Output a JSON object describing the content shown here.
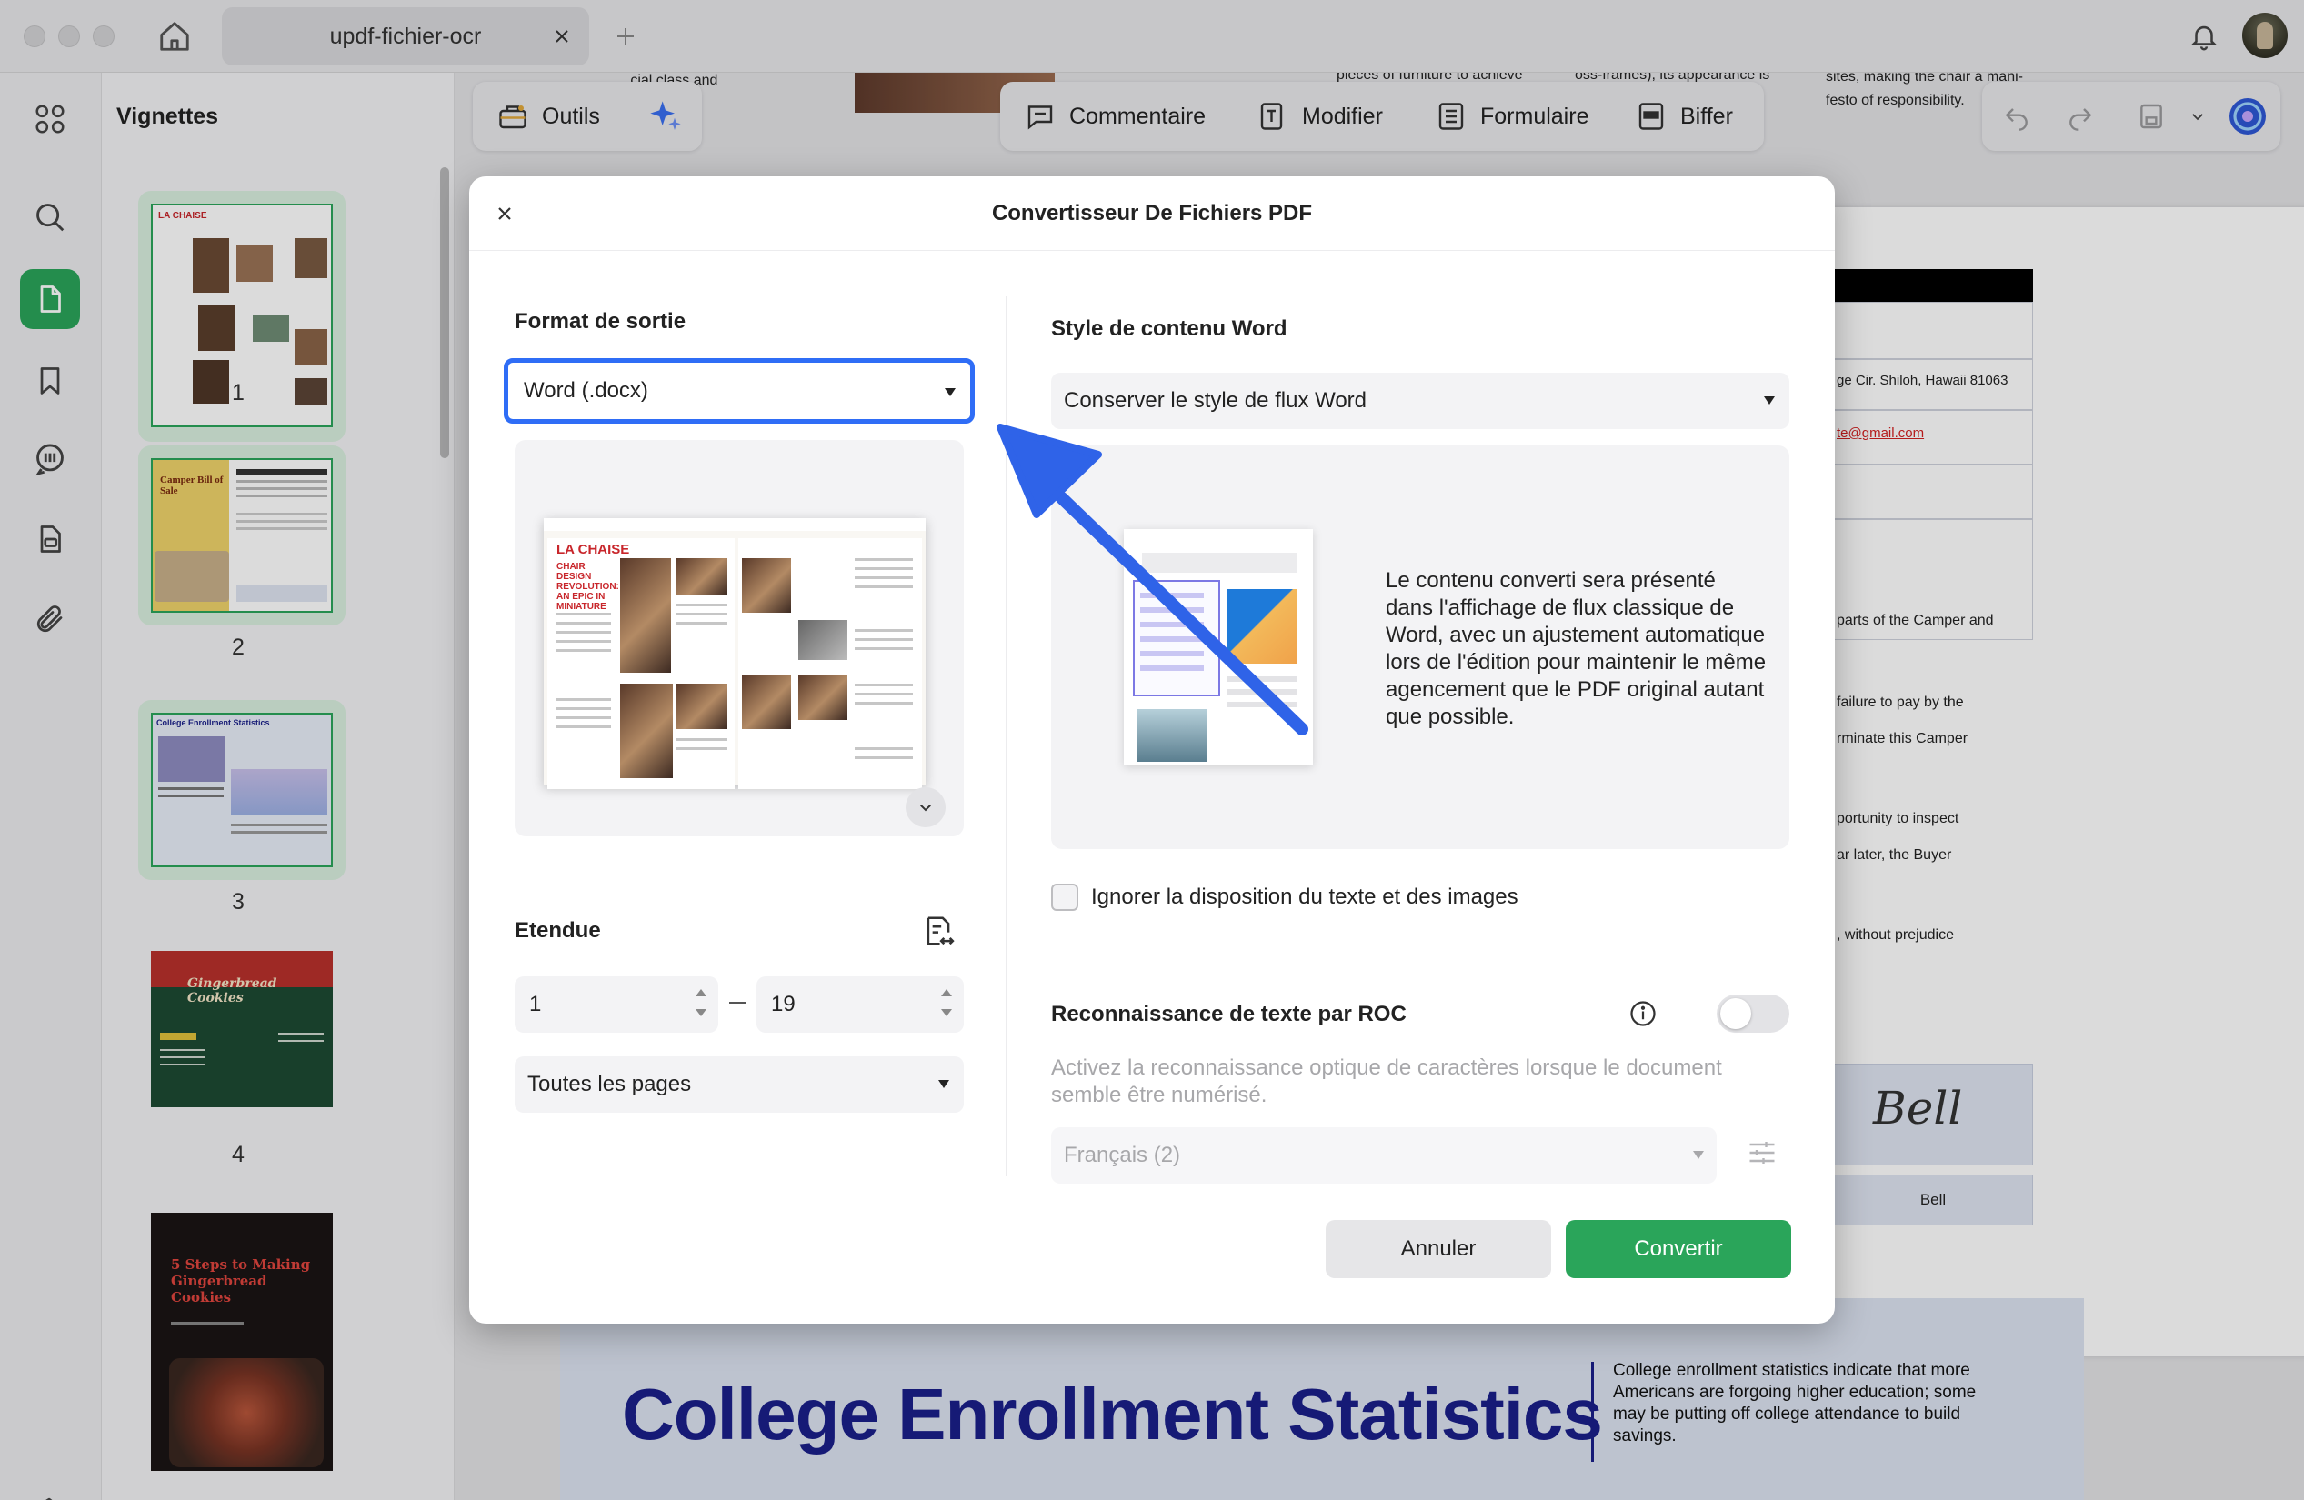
{
  "window": {
    "tab_title": "updf-fichier-ocr"
  },
  "toolbar": {
    "tools_label": "Outils",
    "comment_label": "Commentaire",
    "edit_label": "Modifier",
    "form_label": "Formulaire",
    "redact_label": "Biffer"
  },
  "sidebar": {
    "title": "Vignettes",
    "pages": [
      {
        "number": "1"
      },
      {
        "number": "2"
      },
      {
        "number": "3"
      },
      {
        "number": "4"
      }
    ],
    "thumbnail_texts": {
      "p1_title": "LA CHAISE",
      "p2_title": "Camper Bill of Sale",
      "p3_title": "College Enrollment Statistics",
      "p4_title": "Gingerbread Cookies",
      "p5_title": "5 Steps to Making Gingerbread Cookies"
    }
  },
  "document": {
    "top_snippets": [
      "...cial class and",
      "pieces of furniture to achieve",
      "oss-frames), its appearance is",
      "sites, making the chair a mani-",
      "festo of responsibility."
    ],
    "address": "ge Cir. Shiloh, Hawaii 81063",
    "email": "te@gmail.com",
    "right_snippets": [
      "parts of the Camper and",
      "failure to pay by the",
      "rminate this Camper",
      "portunity to inspect",
      "ar later, the Buyer",
      ", without prejudice"
    ],
    "signature_script": "Bell",
    "signature_name": "Bell",
    "page2_title": "College Enrollment Statistics",
    "page2_text": "College enrollment statistics indicate that more Americans are forgoing higher education; some may be putting off college attendance to build savings."
  },
  "dialog": {
    "title": "Convertisseur De Fichiers PDF",
    "output_format_label": "Format de sortie",
    "output_format_value": "Word (.docx)",
    "preview": {
      "mag_title": "LA CHAISE",
      "mag_sub": "CHAIR DESIGN REVOLUTION: AN EPIC IN MINIATURE"
    },
    "range_label": "Etendue",
    "range_from": "1",
    "range_to": "19",
    "pages_select": "Toutes les pages",
    "word_style_label": "Style de contenu Word",
    "word_style_value": "Conserver le style de flux Word",
    "word_style_description": "Le contenu converti sera présenté dans l'affichage de flux classique de Word, avec un ajustement automatique lors de l'édition pour maintenir le même agencement que le PDF original autant que possible.",
    "ignore_layout_label": "Ignorer la disposition du texte et des images",
    "ignore_layout_checked": false,
    "ocr_label": "Reconnaissance de texte par ROC",
    "ocr_enabled": false,
    "ocr_description": "Activez la reconnaissance optique de caractères lorsque le document semble être numérisé.",
    "ocr_language": "Français (2)",
    "cancel_label": "Annuler",
    "convert_label": "Convertir"
  },
  "colors": {
    "accent_green": "#2aa55a",
    "focus_blue": "#2f6df6",
    "annotation_arrow": "#2f63e8"
  }
}
